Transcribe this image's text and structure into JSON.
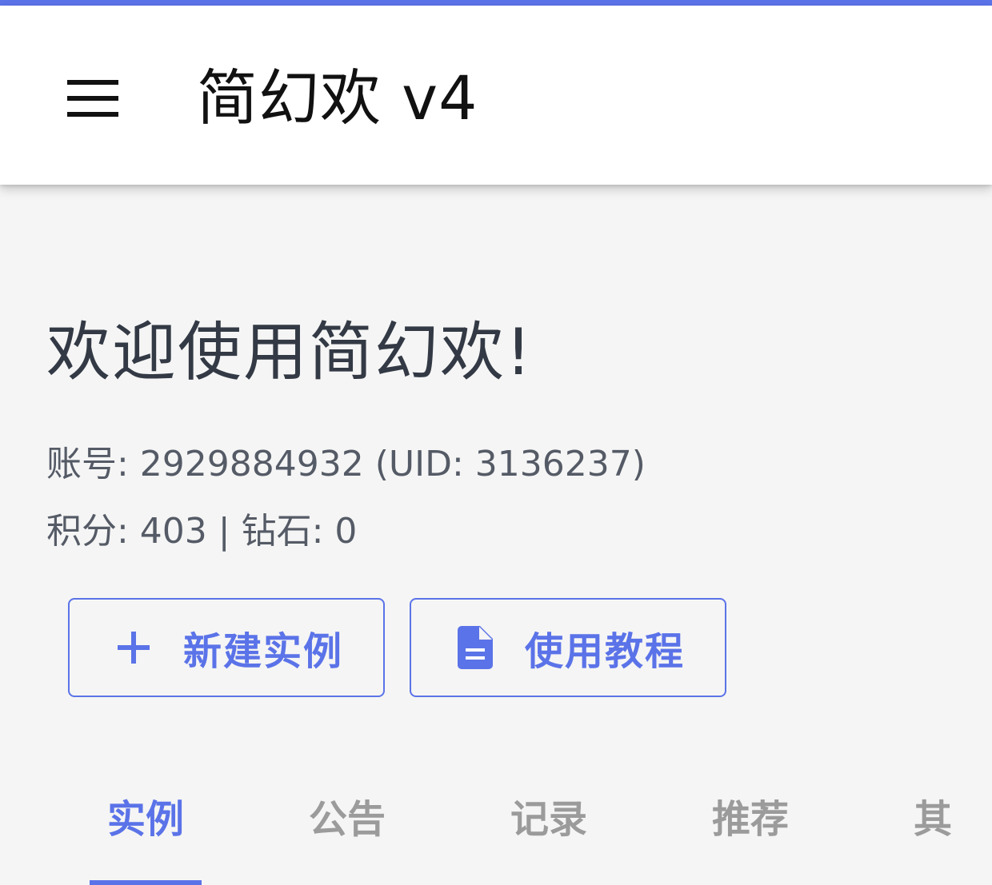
{
  "accent_color": "#5b73e8",
  "app_bar": {
    "menu_icon": "hamburger-menu-icon",
    "title": "简幻欢 v4"
  },
  "main": {
    "welcome": "欢迎使用简幻欢!",
    "account_line": "账号: 2929884932 (UID: 3136237)",
    "points_line": "积分: 403 | 钻石: 0",
    "buttons": [
      {
        "label": "新建实例",
        "icon": "plus-icon"
      },
      {
        "label": "使用教程",
        "icon": "document-icon"
      }
    ]
  },
  "tabs": [
    {
      "label": "实例",
      "active": true
    },
    {
      "label": "公告",
      "active": false
    },
    {
      "label": "记录",
      "active": false
    },
    {
      "label": "推荐",
      "active": false
    },
    {
      "label": "其",
      "active": false
    }
  ]
}
